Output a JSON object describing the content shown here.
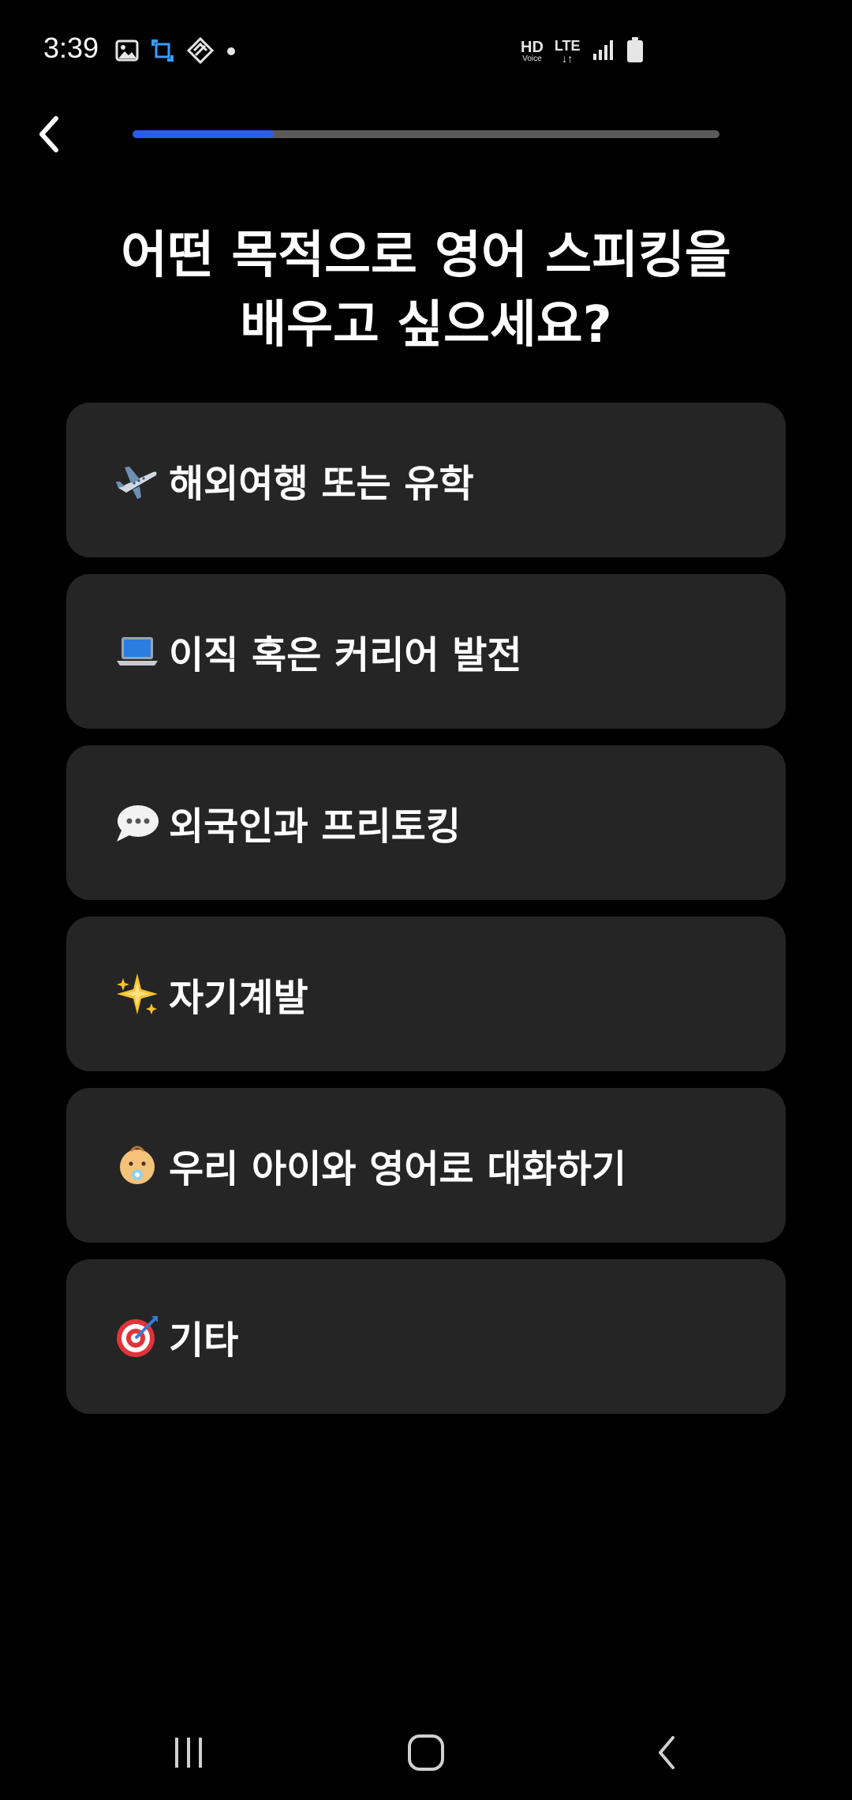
{
  "status_bar": {
    "time": "3:39",
    "left_icons": [
      "gallery-icon",
      "screenshot-icon",
      "app-icon",
      "notification-dot-icon"
    ],
    "hd_voice": {
      "top": "HD",
      "bottom": "Voice"
    },
    "lte": {
      "top": "LTE",
      "bottom": "↓↑"
    },
    "right_icons": [
      "signal-icon",
      "battery-icon"
    ]
  },
  "header": {
    "back_icon": "chevron-left-icon",
    "progress": 0.24,
    "progress_color": "#2a5cf0"
  },
  "question": {
    "line1": "어떤 목적으로 영어 스피킹을",
    "line2": "배우고 싶으세요?"
  },
  "options": [
    {
      "icon": "airplane-icon",
      "label": "해외여행 또는 유학"
    },
    {
      "icon": "laptop-icon",
      "label": "이직 혹은 커리어 발전"
    },
    {
      "icon": "speech-bubble-icon",
      "label": "외국인과 프리토킹"
    },
    {
      "icon": "sparkle-star-icon",
      "label": "자기계발"
    },
    {
      "icon": "baby-icon",
      "label": "우리 아이와 영어로 대화하기"
    },
    {
      "icon": "target-icon",
      "label": "기타"
    }
  ],
  "nav_bar": {
    "buttons": [
      "recent-apps-icon",
      "home-icon",
      "back-icon"
    ]
  },
  "colors": {
    "background": "#000000",
    "card": "#252525",
    "accent": "#2a5cf0",
    "track": "#5a5a5a"
  }
}
